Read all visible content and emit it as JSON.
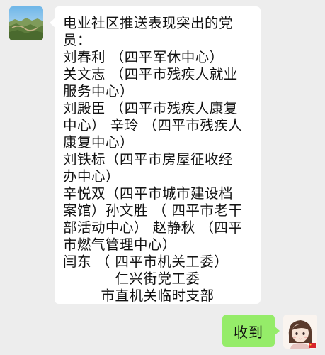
{
  "conversation": {
    "incoming": {
      "avatar_icon": "landscape-avatar-icon",
      "lines": [
        "电业社区推送表现突出的党",
        "员：",
        "刘春利 （四平军休中心）",
        "关文志 （四平市残疾人就业",
        "服务中心）",
        "刘殿臣 （四平市残疾人康复",
        "中心） 辛玲 （四平市残疾人",
        "康复中心）",
        "刘铁标（四平市房屋征收经",
        "办中心）",
        "辛悦双（四平市城市建设档",
        "案馆）孙文胜 （ 四平市老干",
        "部活动中心） 赵静秋 （四平",
        "市燃气管理中心）",
        "闫东 （ 四平市机关工委）",
        "仁兴街党工委",
        "市直机关临时支部"
      ]
    },
    "outgoing": {
      "text": "收到",
      "avatar_icon": "illustrated-girl-avatar-icon"
    },
    "colors": {
      "background": "#ededed",
      "incoming_bubble": "#ffffff",
      "outgoing_bubble": "#95ec69"
    }
  }
}
